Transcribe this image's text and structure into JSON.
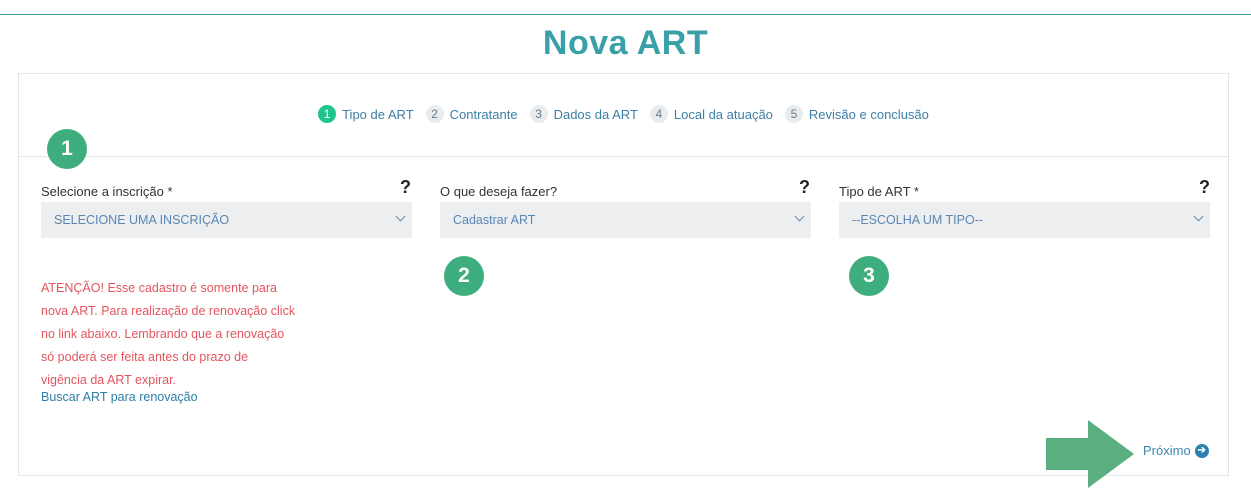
{
  "page": {
    "title": "Nova ART"
  },
  "stepper": {
    "steps": [
      {
        "num": "1",
        "label": "Tipo de ART"
      },
      {
        "num": "2",
        "label": "Contratante"
      },
      {
        "num": "3",
        "label": "Dados da ART"
      },
      {
        "num": "4",
        "label": "Local da atuação"
      },
      {
        "num": "5",
        "label": "Revisão e conclusão"
      }
    ],
    "active_step": 1
  },
  "annotations": [
    "1",
    "2",
    "3"
  ],
  "fields": {
    "inscricao": {
      "label": "Selecione a inscrição *",
      "value": "SELECIONE UMA INSCRIÇÃO",
      "help": "?"
    },
    "acao": {
      "label": "O que deseja fazer?",
      "value": "Cadastrar ART",
      "help": "?"
    },
    "tipo": {
      "label": "Tipo de ART *",
      "value": "--ESCOLHA UM TIPO--",
      "help": "?"
    }
  },
  "warning": {
    "lines": [
      "ATENÇÃO! Esse cadastro é somente para",
      "nova ART. Para realização de renovação click",
      "no link abaixo. Lembrando que a renovação",
      "só poderá ser feita antes do prazo de",
      "vigência da ART expirar."
    ],
    "link": "Buscar ART para renovação"
  },
  "footer": {
    "next_label": "Próximo"
  },
  "colors": {
    "brand": "#3aa0a8",
    "step_active": "#1fc48f",
    "badge": "#3fae7e",
    "warning": "#e2555f",
    "link": "#2f7ea8"
  },
  "icons": {
    "next": "arrow-circle-right-icon",
    "select": "chevron-down-icon",
    "pointer": "arrow-right-icon"
  }
}
